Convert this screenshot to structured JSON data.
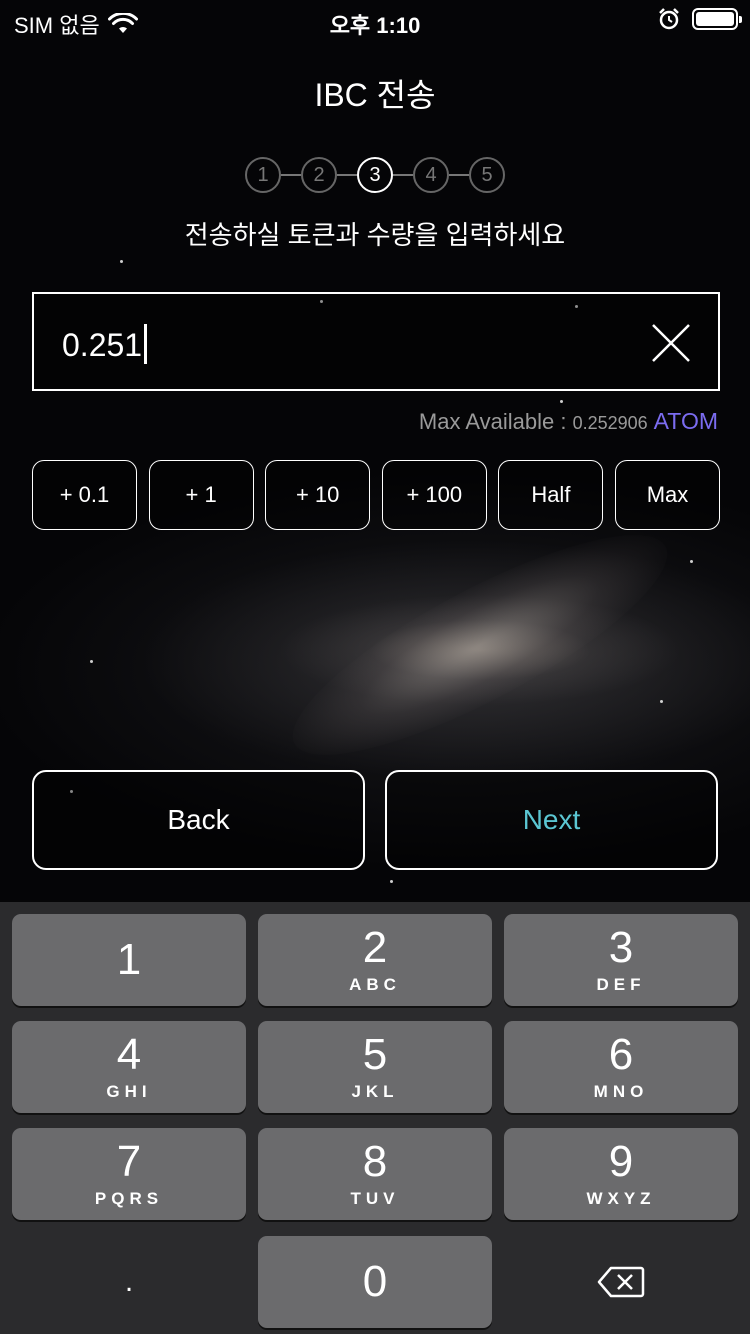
{
  "status_bar": {
    "carrier": "SIM 없음",
    "time": "오후 1:10"
  },
  "title": "IBC 전송",
  "stepper": {
    "steps": [
      "1",
      "2",
      "3",
      "4",
      "5"
    ],
    "active_step": 3
  },
  "subtitle": "전송하실 토큰과 수량을 입력하세요",
  "amount_input": {
    "value": "0.251"
  },
  "max_available": {
    "label": "Max Available : ",
    "value": "0.252906",
    "unit": "ATOM"
  },
  "quick_buttons": [
    "+ 0.1",
    "+ 1",
    "+ 10",
    "+ 100",
    "Half",
    "Max"
  ],
  "nav": {
    "back_label": "Back",
    "next_label": "Next"
  },
  "keyboard": {
    "keys": [
      {
        "digit": "1",
        "letters": ""
      },
      {
        "digit": "2",
        "letters": "ABC"
      },
      {
        "digit": "3",
        "letters": "DEF"
      },
      {
        "digit": "4",
        "letters": "GHI"
      },
      {
        "digit": "5",
        "letters": "JKL"
      },
      {
        "digit": "6",
        "letters": "MNO"
      },
      {
        "digit": "7",
        "letters": "PQRS"
      },
      {
        "digit": "8",
        "letters": "TUV"
      },
      {
        "digit": "9",
        "letters": "WXYZ"
      }
    ],
    "decimal": ".",
    "zero": "0"
  },
  "colors": {
    "accent_next": "#5bc6d3",
    "atom": "#7b6cf0"
  }
}
